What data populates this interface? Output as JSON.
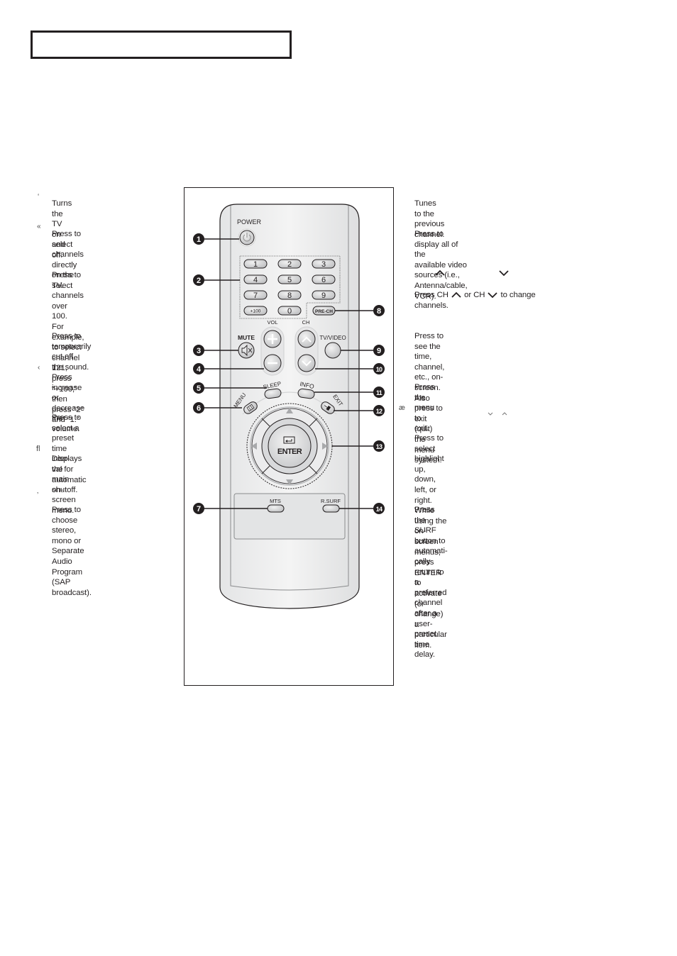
{
  "header": {
    "title": ""
  },
  "left_column": {
    "markers": [
      "‘",
      "«",
      "‹",
      "ﬂ",
      "‚"
    ],
    "items": [
      {
        "id": "power",
        "text": "Turns the TV on and off."
      },
      {
        "id": "numbers",
        "text": "Press to select channels directly\non the TV."
      },
      {
        "id": "plus100",
        "text": "Press to select channels over 100.\nFor example, to select\nchannel 121, press “+100,” then\npress “2” and “1.”"
      },
      {
        "id": "mute",
        "text": "Press to temporarily cut off\nthe sound."
      },
      {
        "id": "volume",
        "text": "Press increase or decrease the\nvolume."
      },
      {
        "id": "sleep",
        "text": "Press to select a preset time inter-\nval for automatic shutoff."
      },
      {
        "id": "menu",
        "text": "Displays the main on-screen\nmenu."
      },
      {
        "id": "mts",
        "text": "Press to choose stereo, mono or\nSeparate Audio Program (SAP\nbroadcast)."
      }
    ]
  },
  "right_column": {
    "markers": [
      "æ"
    ],
    "items": [
      {
        "id": "prech",
        "text": "Tunes to the previous channel."
      },
      {
        "id": "tvvideo",
        "text": "Press to display all of the\navailable video sources (i.e.,\nAntenna/cable, VCR)."
      },
      {
        "id": "ch_prefix",
        "text": "Press CH"
      },
      {
        "id": "ch_or",
        "text": "or CH"
      },
      {
        "id": "ch_suffix",
        "text": "to change"
      },
      {
        "id": "ch_line2",
        "text": "channels."
      },
      {
        "id": "info",
        "text": "Press to see the time, channel,\netc., on-screen. Also press to exit\n(quit) the menu system."
      },
      {
        "id": "exit",
        "text": "Press the menu to exit."
      },
      {
        "id": "arrows",
        "text": "Press to select highlight up, down,\nleft, or right. While using the on-\nscreen menus, press ENTER to\nactivate (or change) a particular\nitem."
      },
      {
        "id": "rsurf",
        "text": "Press the SURF button to automati-\ncally return to a preferred channel\nafter a user-preset time delay."
      }
    ],
    "icons": [
      "chevron-up-icon",
      "chevron-down-icon"
    ]
  },
  "remote": {
    "labels": {
      "power": "POWER",
      "vol": "VOL",
      "ch": "CH",
      "mute": "MUTE",
      "tvvideo": "TV/VIDEO",
      "sleep": "SLEEP",
      "info": "INFO",
      "menu": "MENU",
      "exit": "EXIT",
      "enter": "ENTER",
      "mts": "MTS",
      "rsurf": "R.SURF",
      "prech": "PRE-CH"
    },
    "number_keys": [
      "1",
      "2",
      "3",
      "4",
      "5",
      "6",
      "7",
      "8",
      "9",
      "+100",
      "0"
    ],
    "callouts": [
      "1",
      "2",
      "3",
      "4",
      "5",
      "6",
      "7",
      "8",
      "9",
      "10",
      "11",
      "12",
      "13",
      "14"
    ]
  }
}
